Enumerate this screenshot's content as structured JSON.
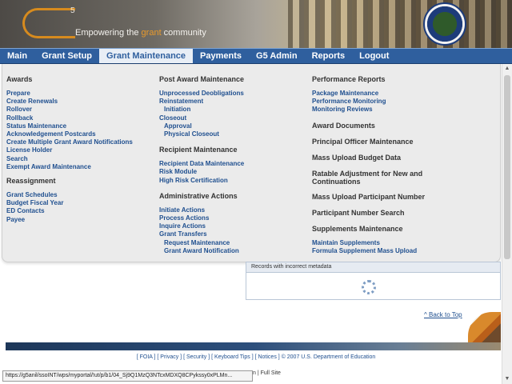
{
  "brand": {
    "logo_text": "G",
    "logo_superscript": "5",
    "tagline_start": "Empowering the ",
    "tagline_accent": "grant",
    "tagline_end": " community",
    "seal_icon": "department-of-education-seal-icon",
    "accent_color": "#d78b1e"
  },
  "nav": {
    "items": [
      "Main",
      "Grant Setup",
      "Grant Maintenance",
      "Payments",
      "G5 Admin",
      "Reports",
      "Logout"
    ],
    "active": "Grant Maintenance",
    "bar_color": "#2f5f9e"
  },
  "menu": {
    "col1": {
      "awards_title": "Awards",
      "awards_links": [
        "Prepare",
        "Create Renewals",
        "Rollover",
        "Rollback",
        "Status Maintenance",
        "Acknowledgement Postcards",
        "Create Multiple Grant Award Notifications",
        "License Holder",
        "Search",
        "Exempt Award Maintenance"
      ],
      "reassign_title": "Reassignment",
      "reassign_links": [
        "Grant Schedules",
        "Budget Fiscal Year",
        "ED Contacts",
        "Payee"
      ]
    },
    "col2": {
      "post_title": "Post Award Maintenance",
      "post_links": [
        "Unprocessed Deobligations",
        "Reinstatement",
        "Initiation",
        "Closeout",
        "Approval",
        "Physical Closeout"
      ],
      "recipient_title": "Recipient Maintenance",
      "recipient_links": [
        "Recipient Data Maintenance",
        "Risk Module",
        "High Risk Certification"
      ],
      "admin_title": "Administrative Actions",
      "admin_links": [
        "Initiate Actions",
        "Process Actions",
        "Inquire Actions",
        "Grant Transfers",
        "Request Maintenance",
        "Grant Award Notification"
      ]
    },
    "col3": {
      "perf_title": "Performance Reports",
      "perf_links": [
        "Package Maintenance",
        "Performance Monitoring",
        "Monitoring Reviews"
      ],
      "award_docs_title": "Award Documents",
      "principal_officer_title": "Principal Officer Maintenance",
      "mass_budget_title": "Mass Upload Budget Data",
      "ratable_title": "Ratable Adjustment for New and Continuations",
      "mass_participant_title": "Mass Upload Participant Number",
      "participant_search_title": "Participant Number Search",
      "supplements_title": "Supplements Maintenance",
      "supplements_links": [
        "Maintain Supplements",
        "Formula Supplement Mass Upload"
      ]
    }
  },
  "content": {
    "records_title": "Records with incorrect metadata",
    "spinner_icon": "loading-spinner-icon",
    "back_to_top": "^ Back to Top"
  },
  "footer": {
    "links": [
      "[ FOIA ]",
      "[ Privacy ]",
      "[ Security ]",
      "[ Keyboard Tips ]",
      "[ Notices ]"
    ],
    "copyright": "© 2007 U.S. Department of Education",
    "full_site_prefix": "n",
    "full_site": "Full Site"
  },
  "status_bar": {
    "url": "https://g5anil/ssoINT/wps/myportal/!ut/p/b1/04_Sj9Q1MzQ3NTcxMDXQ8CPykssy0xPLMn..."
  }
}
